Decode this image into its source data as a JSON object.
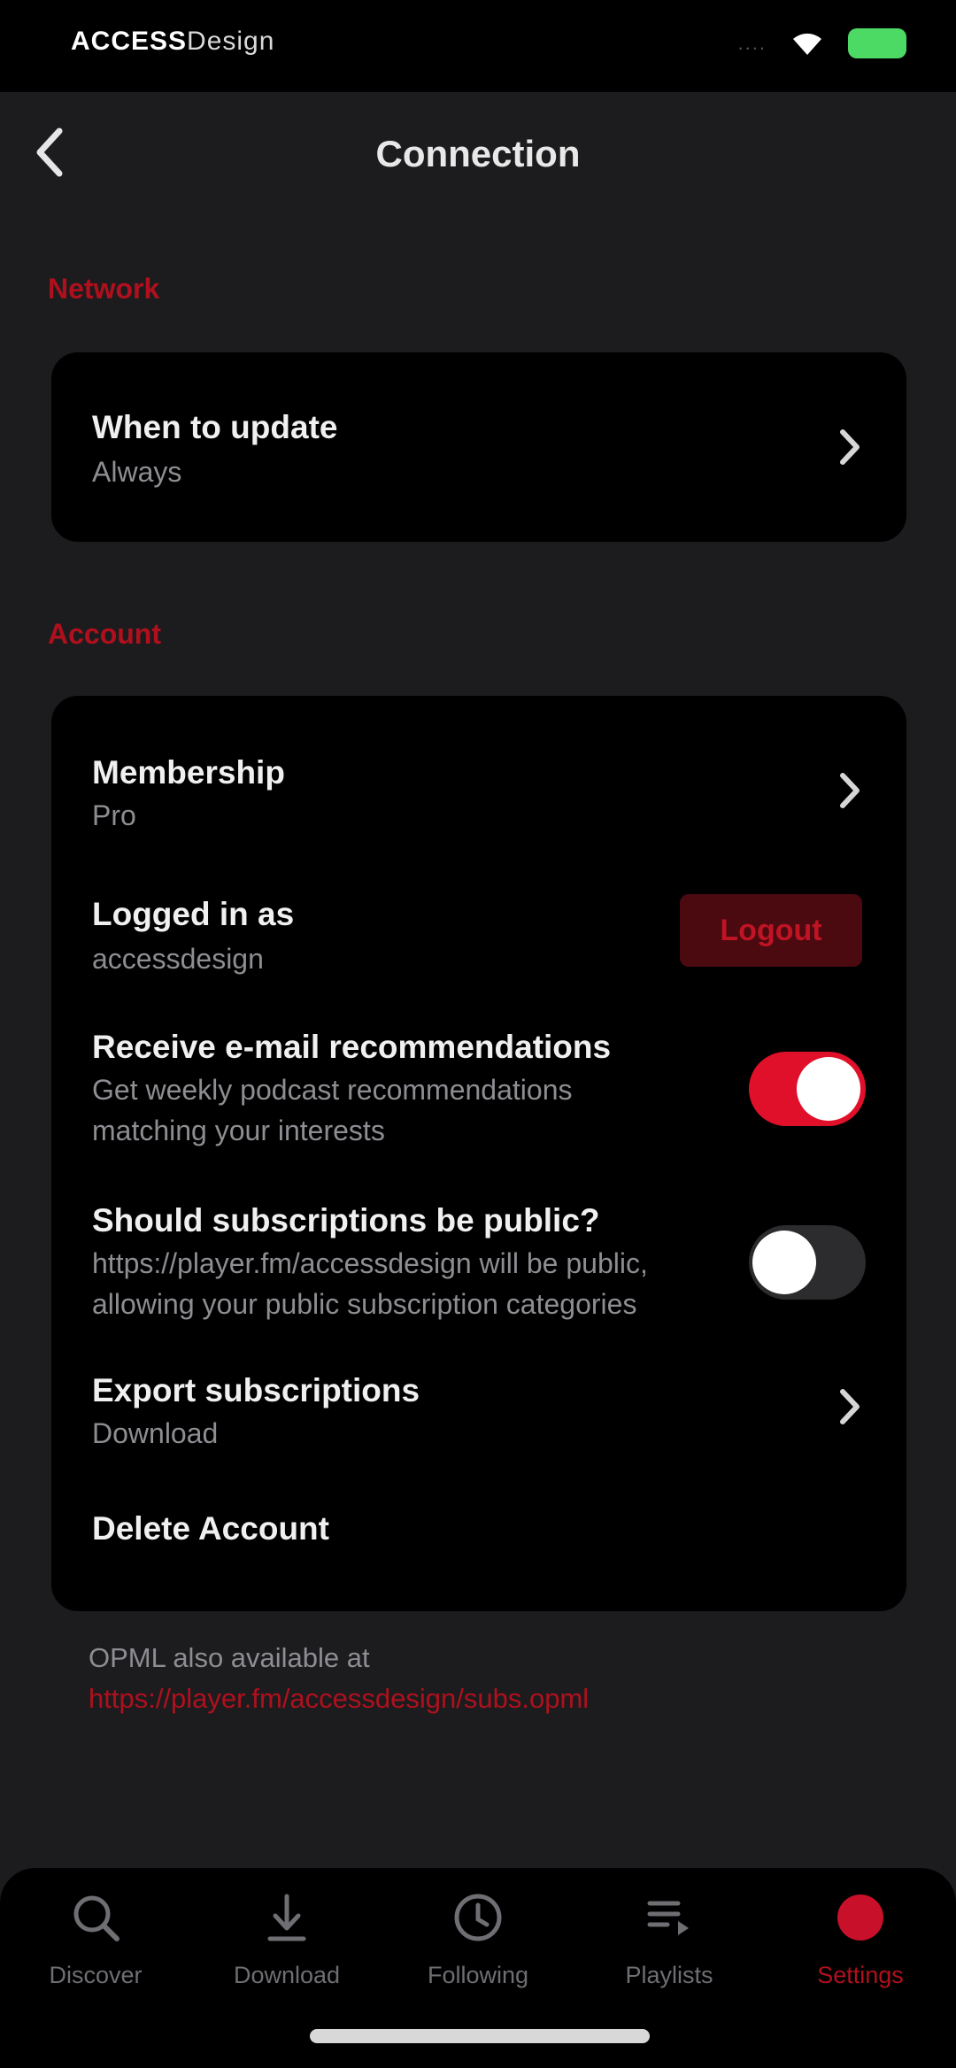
{
  "status_bar": {
    "carrier_bold": "ACCESS",
    "carrier_light": "Design",
    "signal": "....",
    "wifi_icon": "wifi-icon",
    "battery_icon": "battery-icon"
  },
  "nav": {
    "title": "Connection",
    "back_icon": "chevron-left-icon"
  },
  "sections": {
    "network": {
      "header": "Network",
      "when_to_update": {
        "title": "When to update",
        "subtitle": "Always"
      }
    },
    "account": {
      "header": "Account",
      "membership": {
        "title": "Membership",
        "subtitle": "Pro"
      },
      "logged_in": {
        "title": "Logged in as",
        "subtitle": "accessdesign",
        "button": "Logout"
      },
      "email_recs": {
        "title": "Receive e-mail recommendations",
        "subtitle": "Get weekly podcast recommendations matching your interests",
        "enabled": true
      },
      "public_subs": {
        "title": "Should subscriptions be public?",
        "subtitle": "https://player.fm/accessdesign will be public, allowing your public subscription categories",
        "enabled": false
      },
      "export": {
        "title": "Export subscriptions",
        "subtitle": "Download"
      },
      "delete": {
        "title": "Delete Account"
      }
    }
  },
  "footer": {
    "text": "OPML also available at",
    "link": "https://player.fm/accessdesign/subs.opml"
  },
  "tab_bar": {
    "tabs": [
      {
        "label": "Discover",
        "icon": "search-icon"
      },
      {
        "label": "Download",
        "icon": "download-icon"
      },
      {
        "label": "Following",
        "icon": "following-icon"
      },
      {
        "label": "Playlists",
        "icon": "playlist-icon"
      },
      {
        "label": "Settings",
        "icon": "settings-icon",
        "active": true
      }
    ]
  },
  "colors": {
    "accent": "#b0101d",
    "toggle_on": "#e0102a",
    "background": "#1c1c1e",
    "card": "#000000"
  }
}
